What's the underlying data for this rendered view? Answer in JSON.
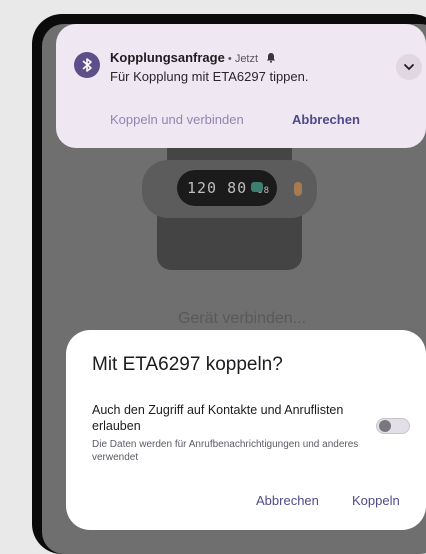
{
  "notification": {
    "app_icon": "bluetooth-icon",
    "title": "Kopplungsanfrage",
    "separator": " • ",
    "time": "Jetzt",
    "alert_icon": "bell-icon",
    "body": "Für Kopplung mit ETA6297 tippen.",
    "expand_icon": "chevron-down-icon",
    "actions": {
      "pair_connect": "Koppeln und verbinden",
      "cancel": "Abbrechen"
    }
  },
  "background": {
    "status_text": "Gerät verbinden...",
    "device_display": "120 80",
    "device_display_sub": "68"
  },
  "dialog": {
    "title": "Mit ETA6297 koppeln?",
    "option_label": "Auch den Zugriff auf Kontakte und Anruflisten erlauben",
    "option_hint": "Die Daten werden für Anrufbenachrichtigungen und anderes verwendet",
    "toggle_on": false,
    "cancel_label": "Abbrechen",
    "pair_label": "Koppeln"
  },
  "colors": {
    "notification_bg": "#efe7f1",
    "accent": "#4f4a8a",
    "scrim": "#6f6f6f"
  }
}
